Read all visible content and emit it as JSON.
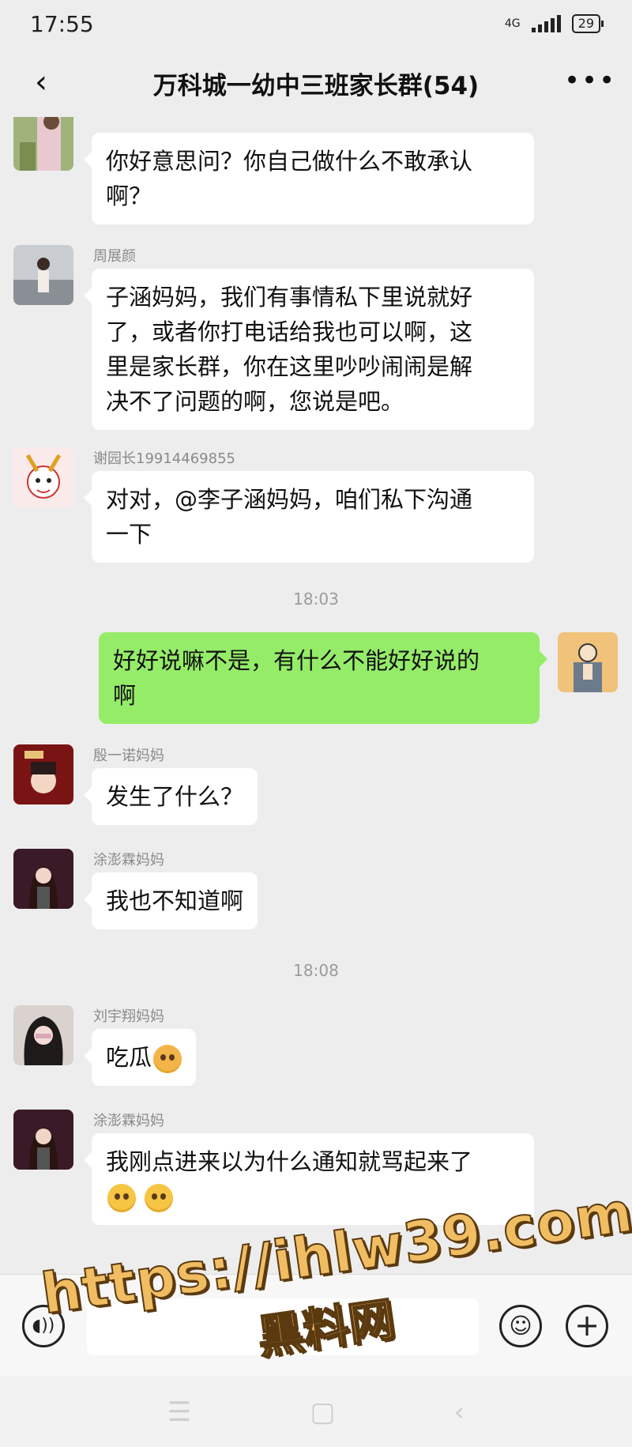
{
  "status_bar": {
    "time": "17:55",
    "network": "4G",
    "battery": "29"
  },
  "nav": {
    "back_icon": "chevron-left-icon",
    "title": "万科城一幼中三班家长群(54)",
    "more_icon": "more-dots-icon"
  },
  "messages": [
    {
      "sender": "",
      "text": "你好意思问？你自己做什么不敢承认啊？",
      "lines": [
        "你好意思问？你自己做什么不敢承认",
        "啊？"
      ]
    },
    {
      "sender": "周展颜",
      "lines": [
        "子涵妈妈，我们有事情私下里说就好",
        "了，或者你打电话给我也可以啊，这",
        "里是家长群，你在这里吵吵闹闹是解",
        "决不了问题的啊，您说是吧。"
      ]
    },
    {
      "sender": "谢园长19914469855",
      "lines": [
        "对对，@李子涵妈妈，咱们私下沟通",
        "一下"
      ]
    },
    {
      "time": "18:03"
    },
    {
      "sender": "me",
      "lines": [
        "好好说嘛不是，有什么不能好好说的",
        "啊"
      ]
    },
    {
      "sender": "殷一诺妈妈",
      "lines": [
        "发生了什么？"
      ]
    },
    {
      "sender": "涂澎霖妈妈",
      "lines": [
        "我也不知道啊"
      ]
    },
    {
      "time": "18:08"
    },
    {
      "sender": "刘宇翔妈妈",
      "lines": [
        "吃瓜"
      ],
      "emoji": "melon-emoji-icon"
    },
    {
      "sender": "涂澎霖妈妈",
      "lines": [
        "我刚点进来以为什么通知就骂起来了"
      ],
      "emoji": "worried-emoji-icon"
    }
  ],
  "m0": {
    "l1": "你好意思问？你自己做什么不敢承认",
    "l2": "啊？"
  },
  "m1": {
    "sender": "周展颜",
    "l1": "子涵妈妈，我们有事情私下里说就好",
    "l2": "了，或者你打电话给我也可以啊，这",
    "l3": "里是家长群，你在这里吵吵闹闹是解",
    "l4": "决不了问题的啊，您说是吧。"
  },
  "m2": {
    "sender": "谢园长19914469855",
    "l1": "对对，@李子涵妈妈，咱们私下沟通",
    "l2": "一下"
  },
  "t1": "18:03",
  "m3": {
    "l1": "好好说嘛不是，有什么不能好好说的",
    "l2": "啊"
  },
  "m4": {
    "sender": "殷一诺妈妈",
    "l1": "发生了什么？"
  },
  "m5": {
    "sender": "涂澎霖妈妈",
    "l1": "我也不知道啊"
  },
  "t2": "18:08",
  "m6": {
    "sender": "刘宇翔妈妈",
    "l1": "吃瓜"
  },
  "m7": {
    "sender": "涂澎霖妈妈",
    "l1": "我刚点进来以为什么通知就骂起来了"
  },
  "input": {
    "voice_icon": "voice-icon",
    "emoji_icon": "smiley-icon",
    "plus_icon": "plus-icon",
    "placeholder": ""
  },
  "watermark": {
    "url": "https://ihlw39.com",
    "name": "黑料网"
  },
  "colors": {
    "background": "#ededed",
    "bubble_mine": "#95ec69",
    "bubble_other": "#ffffff",
    "watermark": "#f0bd63"
  }
}
